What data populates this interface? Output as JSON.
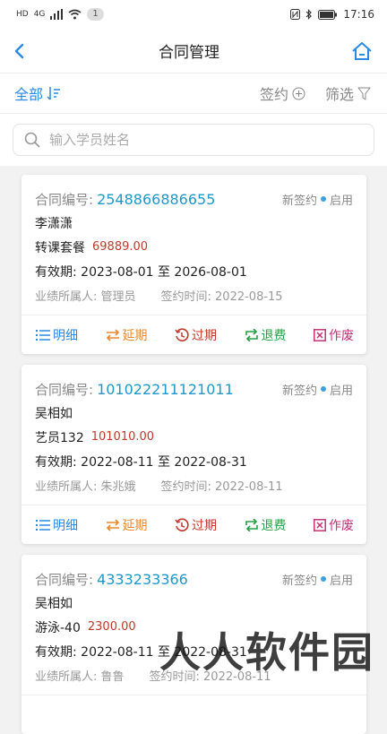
{
  "status_bar": {
    "left_badge": "HD",
    "network": "4G",
    "notif_count": "1",
    "time": "17:16"
  },
  "nav": {
    "title": "合同管理"
  },
  "toolbar": {
    "all_label": "全部",
    "sign_label": "签约",
    "filter_label": "筛选"
  },
  "search": {
    "placeholder": "输入学员姓名",
    "value": ""
  },
  "contracts": [
    {
      "number_label": "合同编号:",
      "number": "2548866886655",
      "status_type": "新签约",
      "status_state": "启用",
      "student": "李潇潇",
      "package": "转课套餐",
      "price": "69889.00",
      "validity": "有效期:  2023-08-01 至 2026-08-01",
      "owner": "业绩所属人:  管理员",
      "sign_time": "签约时间:  2022-08-15"
    },
    {
      "number_label": "合同编号:",
      "number": "101022211121011",
      "status_type": "新签约",
      "status_state": "启用",
      "student": "吴相如",
      "package": "艺员132",
      "price": "101010.00",
      "validity": "有效期:  2022-08-11 至 2022-08-31",
      "owner": "业绩所属人:  朱兆娥",
      "sign_time": "签约时间:  2022-08-11"
    },
    {
      "number_label": "合同编号:",
      "number": "4333233366",
      "status_type": "新签约",
      "status_state": "启用",
      "student": "吴相如",
      "package": "游泳-40",
      "price": "2300.00",
      "validity": "有效期:  2022-08-11 至 2022-08-31",
      "owner": "业绩所属人:  鲁鲁",
      "sign_time": "签约时间:  2022-08-11"
    }
  ],
  "actions": {
    "detail": "明细",
    "extend": "延期",
    "expire": "过期",
    "refund": "退费",
    "void": "作废"
  },
  "colors": {
    "primary": "#2b8ae2",
    "detail": "#2b8ae2",
    "extend": "#e8892f",
    "expire": "#c0392b",
    "refund": "#27a044",
    "void": "#c2307a",
    "price": "#c0392b"
  },
  "watermark": "人人软件园"
}
